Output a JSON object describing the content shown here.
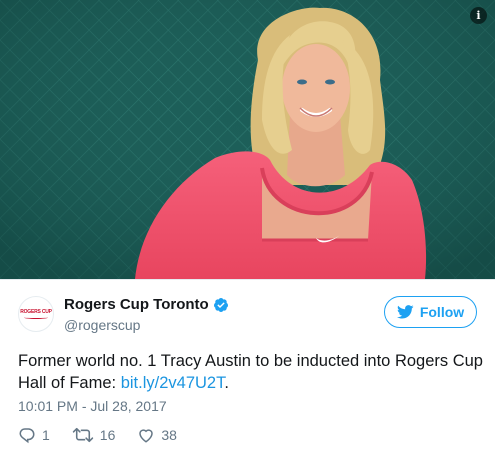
{
  "photo": {
    "alt_subject": "Tracy Austin portrait",
    "colors": {
      "background": "#1c5e58",
      "shirt": "#f0506e",
      "hair": "#e6cf8f"
    }
  },
  "info_icon": {
    "name": "info-icon",
    "glyph": "i"
  },
  "tweet": {
    "author": {
      "display_name": "Rogers Cup Toronto",
      "handle": "@rogerscup",
      "avatar_text": "ROGERS CUP"
    },
    "follow_label": "Follow",
    "text_before_link": "Former world no. 1 Tracy Austin to be inducted into Rogers Cup Hall of Fame: ",
    "link_text": "bit.ly/2v47U2T",
    "text_after_link": ".",
    "timestamp": "10:01 PM - Jul 28, 2017",
    "actions": {
      "reply_count": "1",
      "retweet_count": "16",
      "like_count": "38"
    }
  },
  "colors": {
    "accent": "#1da1f2",
    "link": "#1b95e0",
    "muted": "#657786",
    "text": "#14171a"
  }
}
